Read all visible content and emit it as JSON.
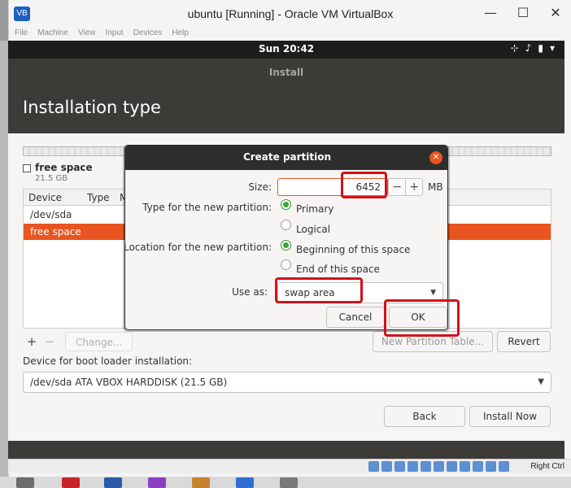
{
  "host_window": {
    "title": "ubuntu [Running] - Oracle VM VirtualBox",
    "app_icon": "virtualbox-icon",
    "controls": {
      "minimize": "—",
      "maximize": "☐",
      "close": "✕"
    },
    "menu": [
      "File",
      "Machine",
      "View",
      "Input",
      "Devices",
      "Help"
    ]
  },
  "gnome": {
    "clock": "Sun 20:42",
    "tray": [
      "network-icon",
      "volume-icon",
      "battery-icon",
      "menu-arrow-icon"
    ]
  },
  "installer": {
    "app_name": "Install",
    "page_title": "Installation type",
    "legend": {
      "name": "free space",
      "size": "21.5 GB"
    },
    "table": {
      "columns": [
        "Device",
        "Type",
        "M"
      ],
      "rows": [
        "/dev/sda",
        "free space"
      ]
    },
    "toolbar": {
      "add": "+",
      "remove": "−",
      "change": "Change..."
    },
    "new_partition_table": "New Partition Table...",
    "revert": "Revert",
    "boot_loader_label": "Device for boot loader installation:",
    "boot_loader_value": "/dev/sda ATA VBOX HARDDISK (21.5 GB)",
    "back": "Back",
    "install_now": "Install Now"
  },
  "dialog": {
    "title": "Create partition",
    "size_label": "Size:",
    "size_value": "6452",
    "size_unit": "MB",
    "stepper_minus": "−",
    "stepper_plus": "+",
    "type_label": "Type for the new partition:",
    "type_options": [
      "Primary",
      "Logical"
    ],
    "type_selected": "Primary",
    "location_label": "Location for the new partition:",
    "location_options": [
      "Beginning of this space",
      "End of this space"
    ],
    "location_selected": "Beginning of this space",
    "use_as_label": "Use as:",
    "use_as_value": "swap area",
    "cancel": "Cancel",
    "ok": "OK"
  },
  "statusbar": {
    "host_key": "Right Ctrl"
  },
  "colors": {
    "accent": "#e95420",
    "annotation": "#d4101a",
    "selected_radio": "#3ca832"
  }
}
